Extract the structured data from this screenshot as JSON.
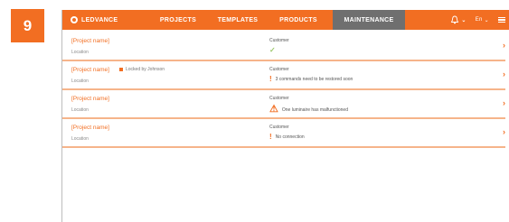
{
  "step_number": "9",
  "nav": {
    "brand": "LEDVANCE",
    "items": [
      {
        "label": "PROJECTS"
      },
      {
        "label": "TEMPLATES"
      },
      {
        "label": "PRODUCTS"
      },
      {
        "label": "MAINTENANCE"
      }
    ],
    "active": "MAINTENANCE",
    "language": "En"
  },
  "projects": [
    {
      "name": "[Project name]",
      "location": "Location",
      "customer": "Customer",
      "status_text": "",
      "status_icon": "check-icon",
      "locked_text": ""
    },
    {
      "name": "[Project name]",
      "location": "Location",
      "customer": "Customer",
      "status_text": "3 commands need to be restored soon",
      "status_icon": "exclamation-icon",
      "locked_text": "Locked by Johnson"
    },
    {
      "name": "[Project name]",
      "location": "Location",
      "customer": "Customer",
      "status_text": "One luminaire has malfunctioned",
      "status_icon": "warning-icon",
      "locked_text": ""
    },
    {
      "name": "[Project name]",
      "location": "Location",
      "customer": "Customer",
      "status_text": "No connection",
      "status_icon": "exclamation-icon",
      "locked_text": ""
    }
  ],
  "colors": {
    "brand_orange": "#f26e22",
    "active_tab": "#6f6f6f",
    "row_divider": "#f6b48a",
    "ok_green": "#9cc86b"
  }
}
